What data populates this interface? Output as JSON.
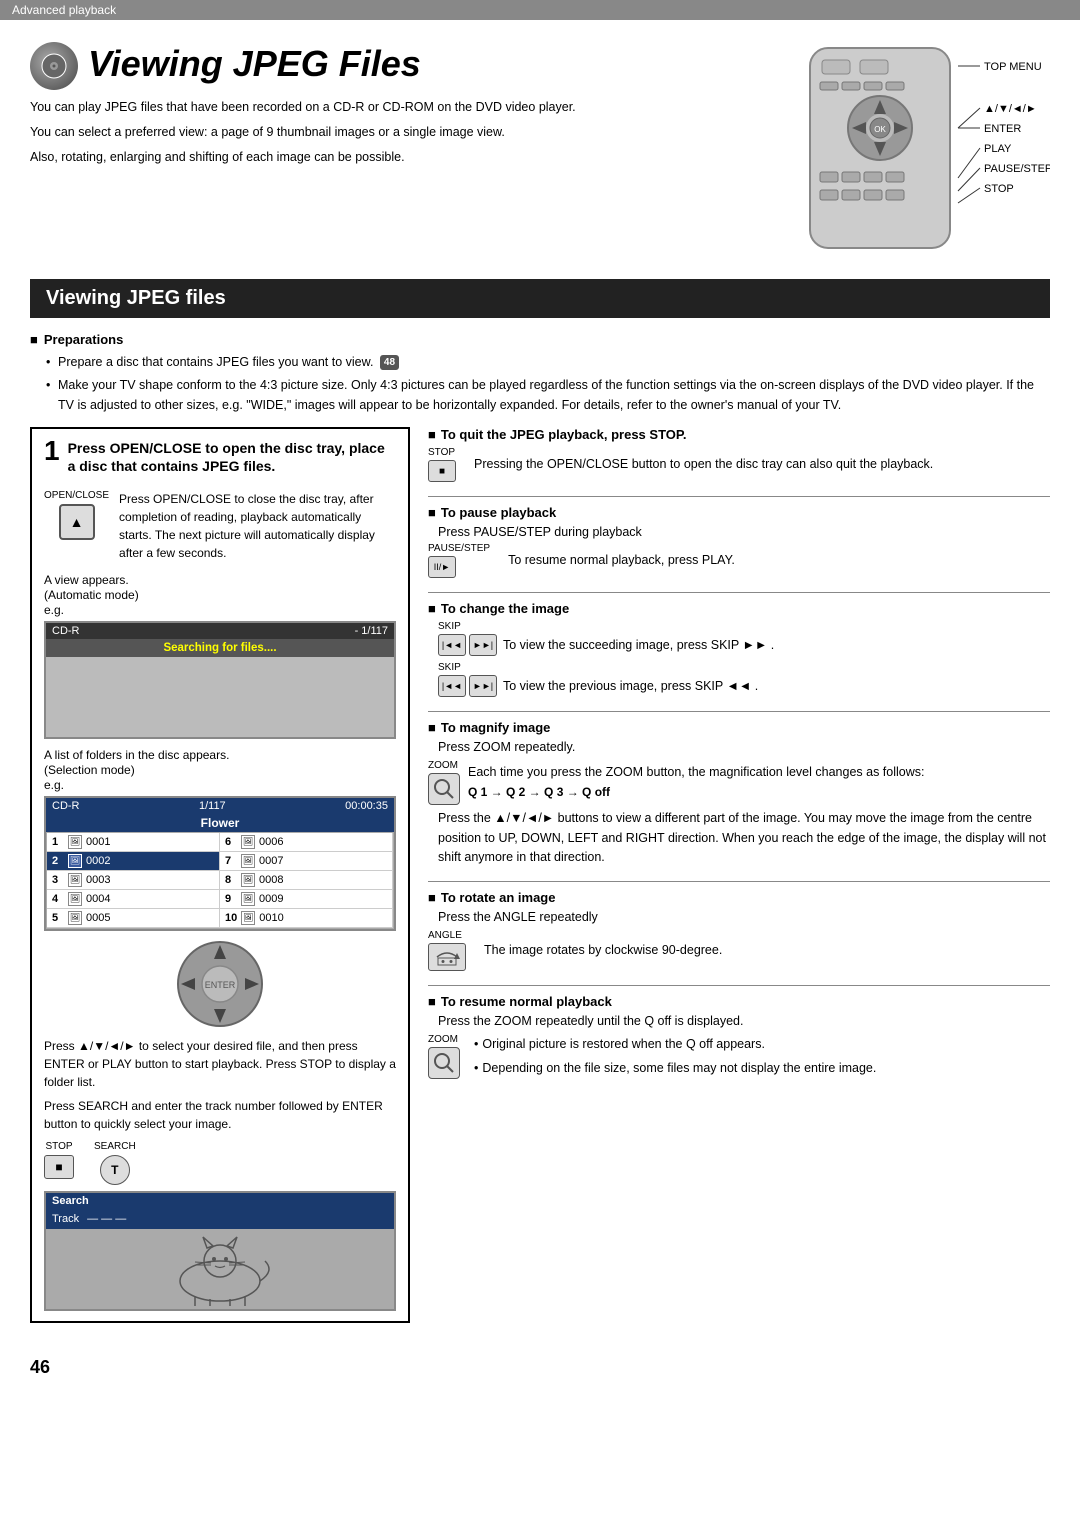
{
  "topbar": {
    "label": "Advanced playback"
  },
  "title": {
    "main": "Viewing JPEG Files",
    "description1": "You can play JPEG files that have been recorded on a CD-R or CD-ROM on the DVD video player.",
    "description2": "You can select a preferred view: a page of 9 thumbnail images or a single image view.",
    "description3": "Also, rotating, enlarging and shifting of each image can be possible."
  },
  "remote_labels": {
    "top_menu": "TOP MENU",
    "arrows": "▲/▼/◄/►",
    "enter": "ENTER",
    "play": "PLAY",
    "pause_step": "PAUSE/STEP",
    "stop": "STOP"
  },
  "section_header": "Viewing JPEG files",
  "preparations": {
    "title": "Preparations",
    "item1": "Prepare a disc that contains JPEG files you want to view.",
    "badge": "48",
    "item2": "Make your TV shape conform to the 4:3 picture size.  Only 4:3 pictures can be played regardless of the function settings via the on-screen displays of the DVD video player.  If the TV is adjusted to other sizes, e.g. \"WIDE,\" images will appear to be horizontally expanded. For details, refer to the owner's manual of your TV."
  },
  "step1": {
    "number": "1",
    "title": "Press OPEN/CLOSE to open the disc tray, place a disc that contains JPEG files.",
    "open_close_label": "OPEN/CLOSE",
    "description": "Press OPEN/CLOSE to close the disc tray, after completion of reading, playback automatically starts. The next picture will automatically display after a few seconds.",
    "view_appears": "A view appears.",
    "auto_mode": "(Automatic mode)",
    "eg": "e.g.",
    "screen1_label_left": "CD-R",
    "screen1_label_right": "- 1/117",
    "searching": "Searching for files....",
    "list_appears": "A list of folders in the disc appears.",
    "selection_mode": "(Selection mode)",
    "eg2": "e.g.",
    "screen2_label_left": "CD-R",
    "screen2_label_mid": "1/117",
    "screen2_label_right": "00:00:35",
    "folder_name": "Flower",
    "files": [
      {
        "num": "1",
        "code": "0001",
        "col": 1
      },
      {
        "num": "2",
        "code": "0002",
        "col": 1,
        "selected": true
      },
      {
        "num": "3",
        "code": "0003",
        "col": 1
      },
      {
        "num": "4",
        "code": "0004",
        "col": 1
      },
      {
        "num": "5",
        "code": "0005",
        "col": 1
      },
      {
        "num": "6",
        "code": "0006",
        "col": 2
      },
      {
        "num": "7",
        "code": "0007",
        "col": 2
      },
      {
        "num": "8",
        "code": "0008",
        "col": 2
      },
      {
        "num": "9",
        "code": "0009",
        "col": 2
      },
      {
        "num": "10",
        "code": "0010",
        "col": 2
      }
    ],
    "nav_desc": "Press ▲/▼/◄/► to select your desired file, and then press ENTER or PLAY button to start playback. Press STOP to display a folder list.",
    "search_desc": "Press SEARCH and enter the track number followed by ENTER button to quickly select your image.",
    "stop_label": "STOP",
    "search_label": "SEARCH",
    "search_screen_title": "Search",
    "search_screen_sub": "Track",
    "search_dashes": "— — —"
  },
  "right_sections": {
    "quit": {
      "title": "To quit the JPEG playback, press STOP.",
      "stop_label": "STOP",
      "desc": "Pressing the OPEN/CLOSE button to open the disc tray can also quit the playback."
    },
    "pause": {
      "title": "To pause playback",
      "desc1": "Press PAUSE/STEP during playback",
      "pause_label": "PAUSE/STEP",
      "desc2": "To resume normal playback, press PLAY."
    },
    "change_image": {
      "title": "To change the image",
      "skip_label": "SKIP",
      "desc1": "To view the succeeding image, press SKIP ►► .",
      "desc2": "To view the previous image, press SKIP ◄◄ ."
    },
    "magnify": {
      "title": "To magnify image",
      "desc1": "Press ZOOM repeatedly.",
      "zoom_label": "ZOOM",
      "desc2": "Each time you press the ZOOM button, the magnification level changes as follows:",
      "chain": "Q 1  →  Q 2  →  Q 3  →  Q off",
      "desc3": "Press the ▲/▼/◄/► buttons to view a different part of the image. You may move the image from the centre position to UP, DOWN, LEFT and RIGHT direction.  When you reach the edge of the image, the display will not shift anymore in that direction."
    },
    "rotate": {
      "title": "To rotate an image",
      "desc1": "Press the ANGLE repeatedly",
      "angle_label": "ANGLE",
      "desc2": "The image rotates by clockwise 90-degree."
    },
    "resume": {
      "title": "To resume normal playback",
      "desc1": "Press the ZOOM repeatedly until the Q off is displayed.",
      "zoom_label": "ZOOM",
      "bullet1": "Original picture is restored when the Q off appears.",
      "bullet2": "Depending on the file size, some files may not display the entire image."
    }
  },
  "page_number": "46"
}
